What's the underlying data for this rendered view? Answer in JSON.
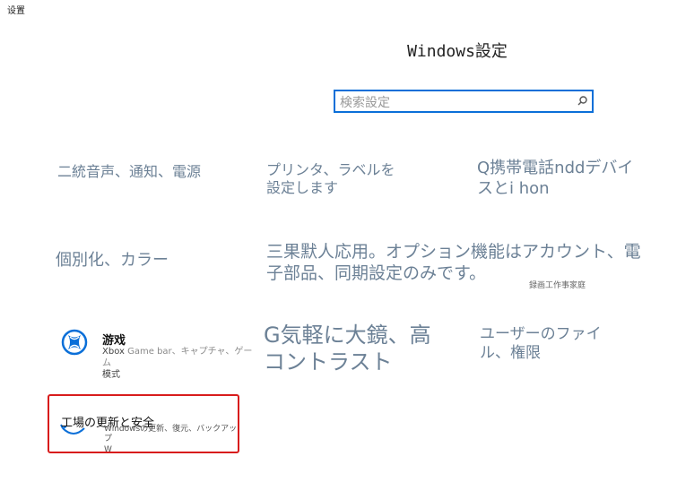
{
  "window": {
    "title": "设置"
  },
  "header": {
    "title": "Windows設定"
  },
  "search": {
    "placeholder": "検索設定",
    "icon": "search-icon"
  },
  "tiles": [
    {
      "id": "system",
      "text": "二統音声、通知、電源"
    },
    {
      "id": "devices",
      "text": "プリンタ、ラベルを設定します"
    },
    {
      "id": "phone",
      "text": "Q携帯電話nddデバイスとi hon"
    },
    {
      "id": "personalization",
      "text": "個別化、カラー"
    },
    {
      "id": "apps",
      "text": "三果默人応用。オプション機能はアカウント、電子部品、同期設定のみです。"
    },
    {
      "id": "family",
      "text": "録画工作事家庭"
    },
    {
      "id": "ease",
      "text": "G気軽に大鏡、高コントラスト"
    },
    {
      "id": "accounts",
      "text": "ユーザーのファイル、権限"
    }
  ],
  "gaming": {
    "title": "游戏",
    "desc_line1": "Xbox",
    "desc_line1b": "Game bar、キャプチャ、ゲーム",
    "desc_line2": "模式",
    "icon": "xbox-icon"
  },
  "update": {
    "title": "工場の更新と安全",
    "desc": "Windowsの更新、復元、バックアップ",
    "extra": "W",
    "icon": "refresh-icon"
  },
  "colors": {
    "accent": "#0b6fd8",
    "highlight": "#d81c1c",
    "tile_text": "#6c8196"
  }
}
